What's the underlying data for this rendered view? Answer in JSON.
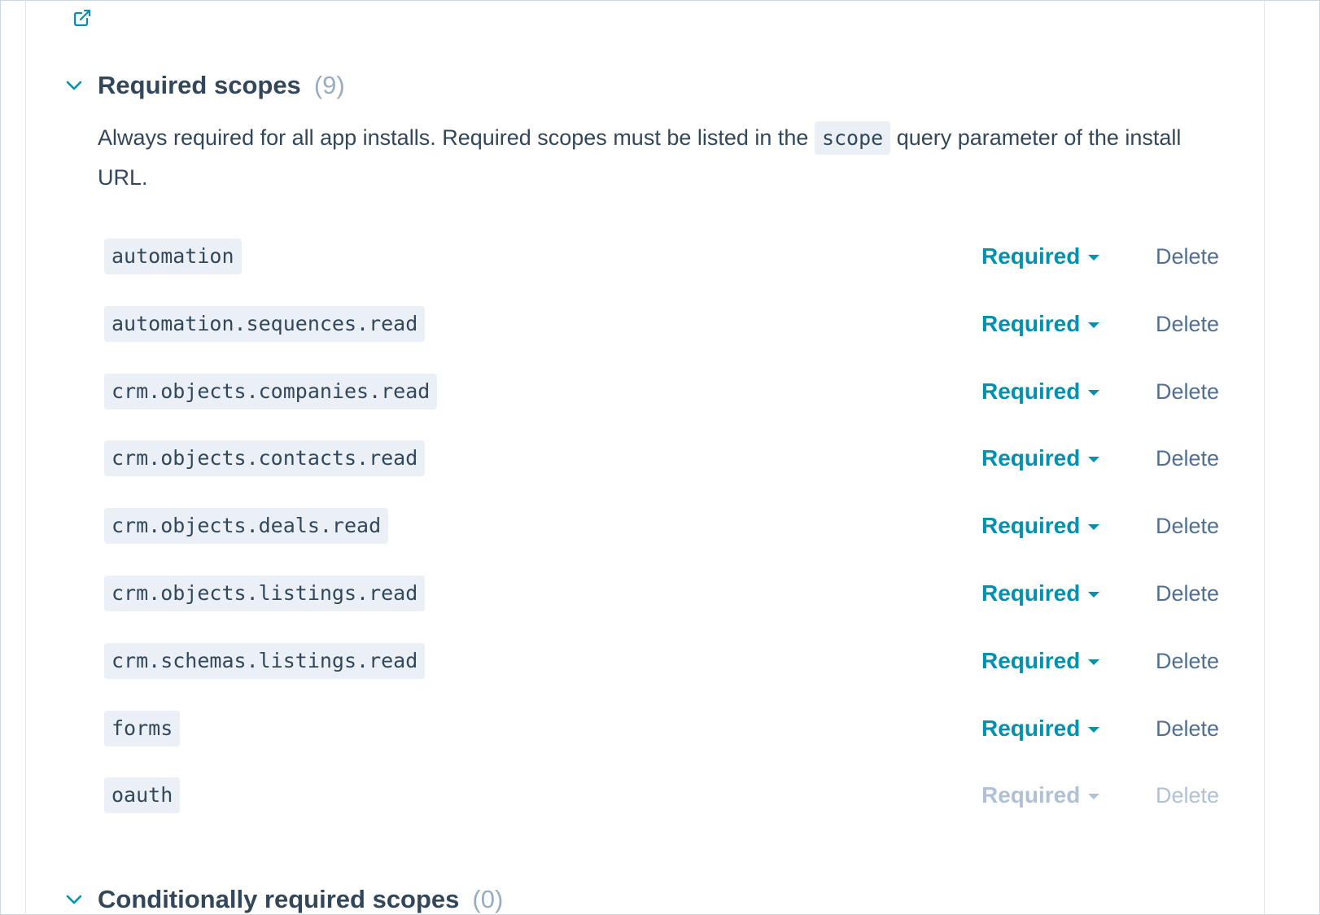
{
  "external_link_icon": "external-link-icon",
  "required_section": {
    "title": "Required scopes",
    "count": "(9)",
    "chevron_icon": "chevron-down-icon",
    "description_before": "Always required for all app installs. Required scopes must be listed in the ",
    "description_code": "scope",
    "description_after": " query parameter of the install URL."
  },
  "scopes": [
    {
      "name": "automation",
      "requirement": "Required",
      "delete_label": "Delete",
      "disabled": false
    },
    {
      "name": "automation.sequences.read",
      "requirement": "Required",
      "delete_label": "Delete",
      "disabled": false
    },
    {
      "name": "crm.objects.companies.read",
      "requirement": "Required",
      "delete_label": "Delete",
      "disabled": false
    },
    {
      "name": "crm.objects.contacts.read",
      "requirement": "Required",
      "delete_label": "Delete",
      "disabled": false
    },
    {
      "name": "crm.objects.deals.read",
      "requirement": "Required",
      "delete_label": "Delete",
      "disabled": false
    },
    {
      "name": "crm.objects.listings.read",
      "requirement": "Required",
      "delete_label": "Delete",
      "disabled": false
    },
    {
      "name": "crm.schemas.listings.read",
      "requirement": "Required",
      "delete_label": "Delete",
      "disabled": false
    },
    {
      "name": "forms",
      "requirement": "Required",
      "delete_label": "Delete",
      "disabled": false
    },
    {
      "name": "oauth",
      "requirement": "Required",
      "delete_label": "Delete",
      "disabled": true
    }
  ],
  "conditional_section": {
    "title": "Conditionally required scopes",
    "count": "(0)",
    "chevron_icon": "chevron-down-icon"
  },
  "colors": {
    "accent": "#0091ae",
    "text": "#33475b",
    "muted": "#99acc2",
    "chip_bg": "#eaf0f6",
    "disabled": "#b0c1d4"
  }
}
